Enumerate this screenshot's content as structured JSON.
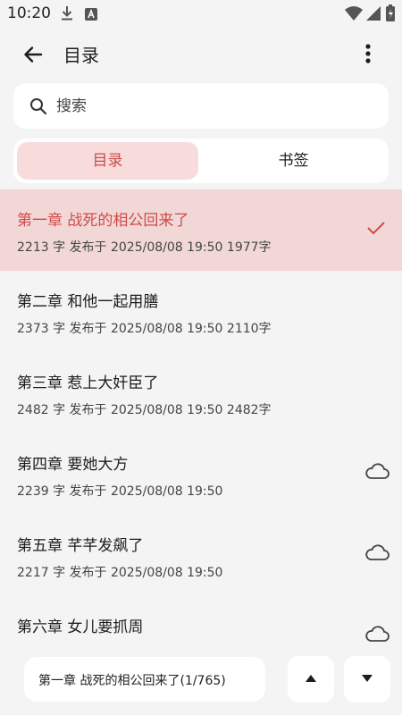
{
  "status_bar": {
    "time": "10:20"
  },
  "appbar": {
    "title": "目录"
  },
  "search": {
    "placeholder": "搜索"
  },
  "tabs": [
    {
      "label": "目录",
      "active": true
    },
    {
      "label": "书签",
      "active": false
    }
  ],
  "chapters": [
    {
      "title": "第一章 战死的相公回来了",
      "meta": "2213 字 发布于  2025/08/08 19:50  1977字",
      "current": true,
      "status_icon": "check-icon"
    },
    {
      "title": "第二章 和他一起用膳",
      "meta": "2373 字 发布于  2025/08/08 19:50  2110字",
      "current": false,
      "status_icon": ""
    },
    {
      "title": "第三章 惹上大奸臣了",
      "meta": "2482 字 发布于  2025/08/08 19:50  2482字",
      "current": false,
      "status_icon": ""
    },
    {
      "title": "第四章 要她大方",
      "meta": "2239 字 发布于  2025/08/08 19:50",
      "current": false,
      "status_icon": "cloud-icon"
    },
    {
      "title": "第五章 芊芊发飙了",
      "meta": "2217 字 发布于  2025/08/08 19:50",
      "current": false,
      "status_icon": "cloud-icon"
    },
    {
      "title": "第六章 女儿要抓周",
      "meta": "",
      "current": false,
      "status_icon": "cloud-icon"
    }
  ],
  "footer": {
    "current_chapter": "第一章 战死的相公回来了(1/765)"
  },
  "colors": {
    "accent": "#d14a4a",
    "current_row_bg": "#f2d7d7",
    "active_tab_bg": "#f8dcdc"
  }
}
